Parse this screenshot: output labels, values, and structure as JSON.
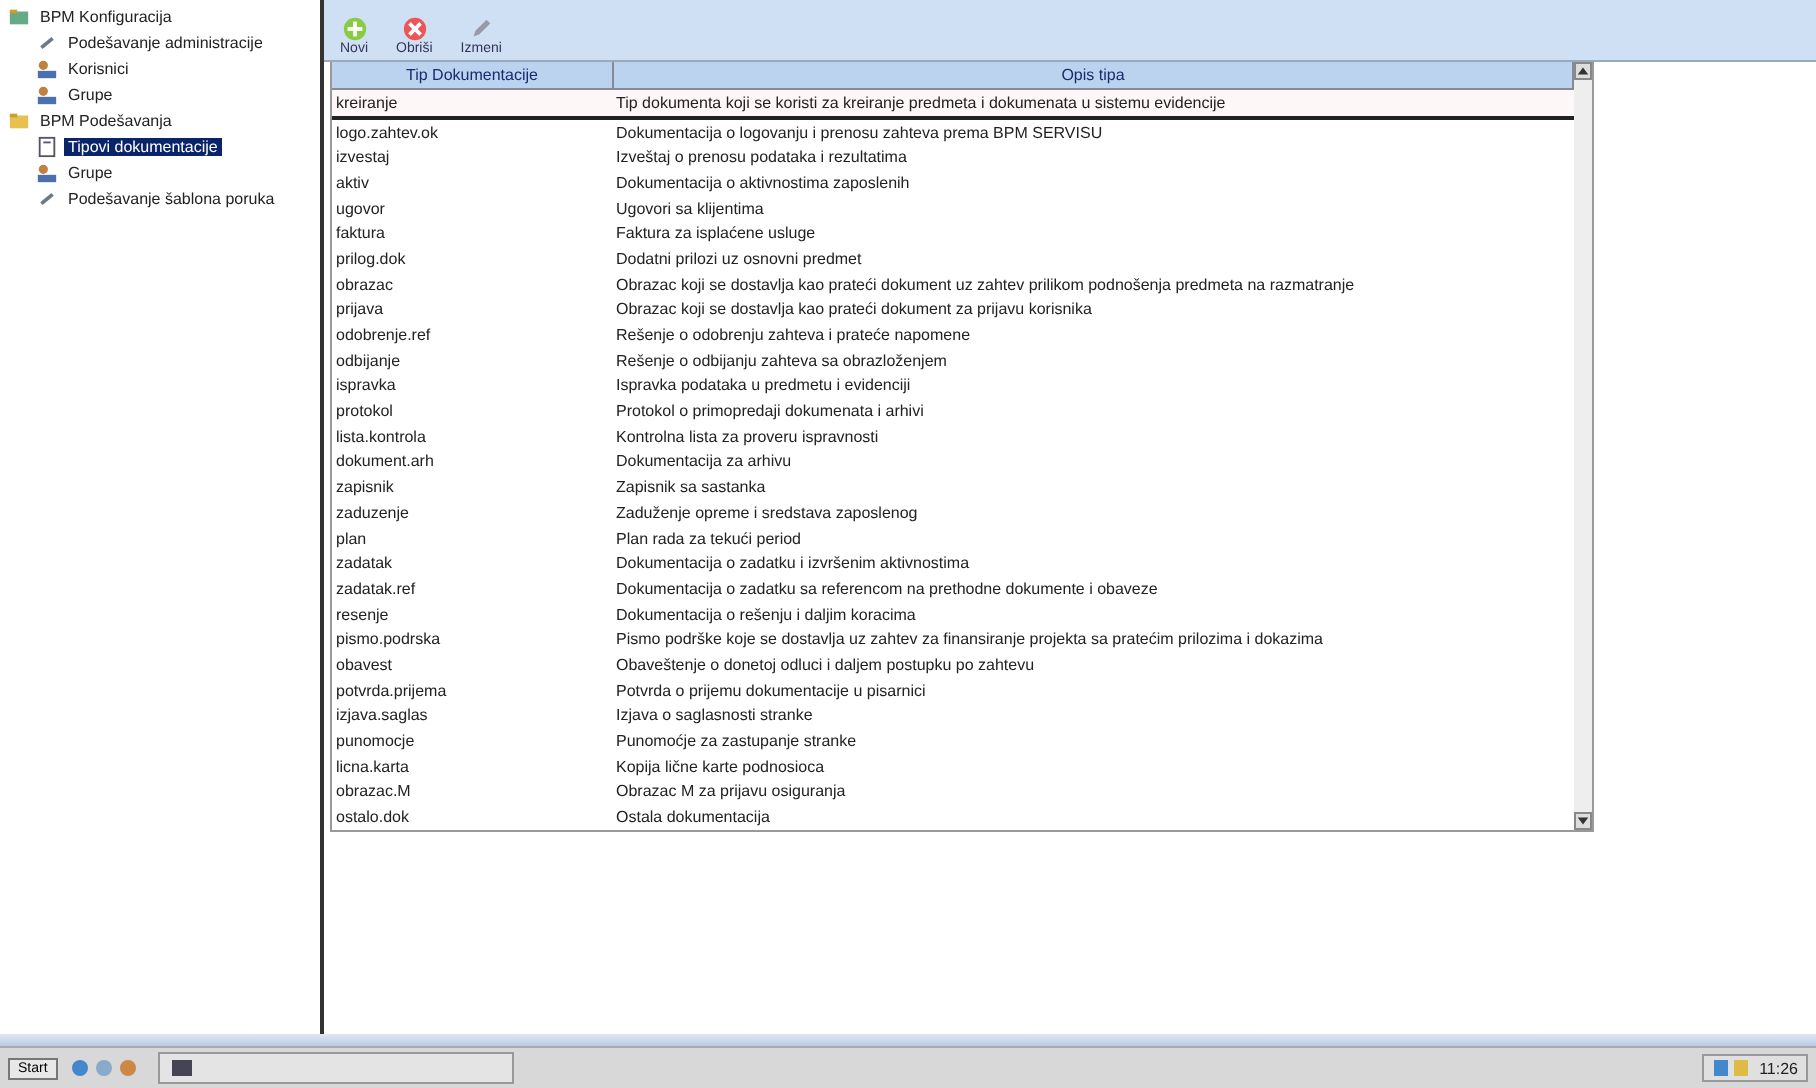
{
  "tree": [
    {
      "label": "BPM Konfiguracija",
      "kind": "server",
      "children": [
        {
          "label": "Podešavanje administracije",
          "kind": "tools",
          "selected": false
        },
        {
          "label": "Korisnici",
          "kind": "users",
          "selected": false
        },
        {
          "label": "Grupe",
          "kind": "users",
          "selected": false
        }
      ]
    },
    {
      "label": "BPM Podešavanja",
      "kind": "folder",
      "children": [
        {
          "label": "Tipovi dokumentacije",
          "kind": "docs",
          "selected": true
        },
        {
          "label": "Grupe",
          "kind": "users",
          "selected": false
        },
        {
          "label": "Podešavanje šablona poruka",
          "kind": "tools",
          "selected": false
        }
      ]
    }
  ],
  "toolbar": [
    {
      "label": "Novi",
      "kind": "add"
    },
    {
      "label": "Obriši",
      "kind": "delete"
    },
    {
      "label": "Izmeni",
      "kind": "edit"
    }
  ],
  "table": {
    "columns": [
      "Tip Dokumentacije",
      "Opis tipa"
    ],
    "rows": [
      [
        "kreiranje",
        "Tip dokumenta koji se koristi za kreiranje predmeta i dokumenata u sistemu evidencije"
      ],
      [
        "logo.zahtev.ok",
        "Dokumentacija o logovanju i prenosu zahteva prema BPM SERVISU"
      ],
      [
        "izvestaj",
        "Izveštaj o prenosu podataka i rezultatima"
      ],
      [
        "aktiv",
        "Dokumentacija o aktivnostima zaposlenih"
      ],
      [
        "ugovor",
        "Ugovori sa klijentima"
      ],
      [
        "faktura",
        "Faktura za isplaćene usluge"
      ],
      [
        "prilog.dok",
        "Dodatni prilozi uz osnovni predmet"
      ],
      [
        "obrazac",
        "Obrazac koji se dostavlja kao prateći dokument uz zahtev prilikom podnošenja predmeta na razmatranje"
      ],
      [
        "prijava",
        "Obrazac koji se dostavlja kao prateći dokument za prijavu korisnika"
      ],
      [
        "odobrenje.ref",
        "Rešenje o odobrenju zahteva i prateće napomene"
      ],
      [
        "odbijanje",
        "Rešenje o odbijanju zahteva sa obrazloženjem"
      ],
      [
        "ispravka",
        "Ispravka podataka u predmetu i evidenciji"
      ],
      [
        "protokol",
        "Protokol o primopredaji dokumenata i arhivi"
      ],
      [
        "lista.kontrola",
        "Kontrolna lista za proveru ispravnosti"
      ],
      [
        "dokument.arh",
        "Dokumentacija za arhivu"
      ],
      [
        "zapisnik",
        "Zapisnik sa sastanka"
      ],
      [
        "zaduzenje",
        "Zaduženje opreme i sredstava zaposlenog"
      ],
      [
        "plan",
        "Plan rada za tekući period"
      ],
      [
        "zadatak",
        "Dokumentacija o zadatku i izvršenim aktivnostima"
      ],
      [
        "zadatak.ref",
        "Dokumentacija o zadatku sa referencom na prethodne dokumente i obaveze"
      ],
      [
        "resenje",
        "Dokumentacija o rešenju i daljim koracima"
      ],
      [
        "pismo.podrska",
        "Pismo podrške koje se dostavlja uz zahtev za finansiranje projekta sa pratećim prilozima i dokazima"
      ],
      [
        "obavest",
        "Obaveštenje o donetoj odluci i daljem postupku po zahtevu"
      ],
      [
        "potvrda.prijema",
        "Potvrda o prijemu dokumentacije u pisarnici"
      ],
      [
        "izjava.saglas",
        "Izjava o saglasnosti stranke"
      ],
      [
        "punomocje",
        "Punomoćje za zastupanje stranke"
      ],
      [
        "licna.karta",
        "Kopija lične karte podnosioca"
      ],
      [
        "obrazac.M",
        "Obrazac M za prijavu osiguranja"
      ],
      [
        "ostalo.dok",
        "Ostala dokumentacija"
      ]
    ]
  },
  "taskbar": {
    "start": "Start",
    "clock": "11:26"
  }
}
